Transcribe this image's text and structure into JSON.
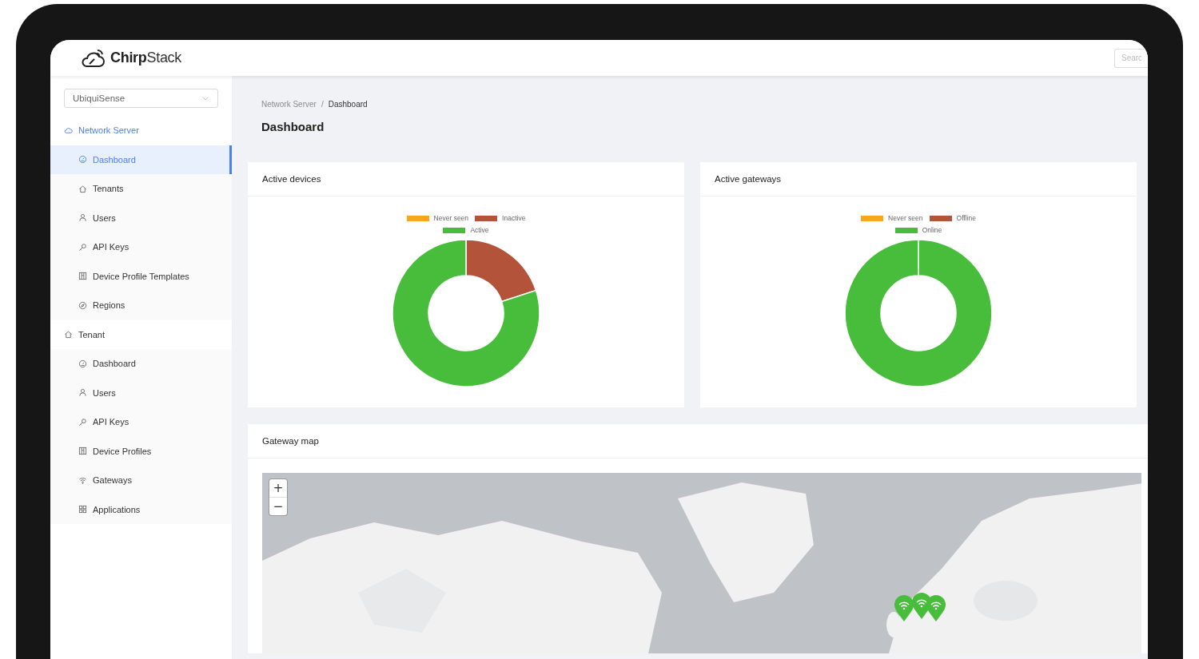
{
  "header": {
    "logo": "**Chirp**Stack",
    "search": {
      "placeholder": "Searc"
    }
  },
  "sidebar": {
    "tenant_select": {
      "value": "UbiquiSense"
    },
    "groups": [
      {
        "label": "Network Server",
        "selected": true,
        "children": [
          {
            "label": "Dashboard",
            "selected": true
          },
          {
            "label": "Tenants",
            "selected": false
          },
          {
            "label": "Users",
            "selected": false
          },
          {
            "label": "API Keys",
            "selected": false
          },
          {
            "label": "Device Profile Templates",
            "selected": false
          },
          {
            "label": "Regions",
            "selected": false
          }
        ]
      },
      {
        "label": "Tenant",
        "selected": false,
        "children": [
          {
            "label": "Dashboard",
            "selected": false
          },
          {
            "label": "Users",
            "selected": false
          },
          {
            "label": "API Keys",
            "selected": false
          },
          {
            "label": "Device Profiles",
            "selected": false
          },
          {
            "label": "Gateways",
            "selected": false
          },
          {
            "label": "Applications",
            "selected": false
          }
        ]
      }
    ]
  },
  "breadcrumb": {
    "items": [
      "Network Server",
      "Dashboard"
    ],
    "separator": "/"
  },
  "title": "Dashboard",
  "cards": [
    {
      "title": "Active devices",
      "legend": [
        {
          "label": "Never seen",
          "color": "#faa61a"
        },
        {
          "label": "Inactive",
          "color": "#b2533a"
        },
        {
          "label": "Active",
          "color": "#48bc3b"
        }
      ]
    },
    {
      "title": "Active gateways",
      "legend": [
        {
          "label": "Never seen",
          "color": "#faa61a"
        },
        {
          "label": "Offline",
          "color": "#b2533a"
        },
        {
          "label": "Online",
          "color": "#48bc3b"
        }
      ]
    }
  ],
  "gateway_map": {
    "title": "Gateway map",
    "zoom_in": "+",
    "zoom_out": "−"
  }
}
